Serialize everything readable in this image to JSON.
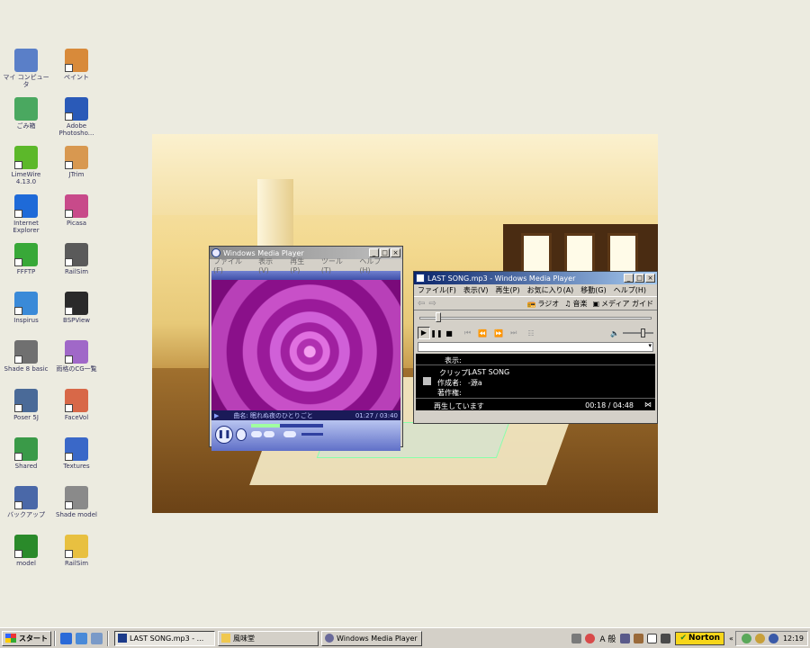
{
  "desktop": {
    "icons": [
      {
        "label": "マイ コンピュータ",
        "color": "#5a7fc8"
      },
      {
        "label": "ペイント",
        "color": "#d88a3a"
      },
      {
        "label": "ごみ箱",
        "color": "#4aa860"
      },
      {
        "label": "Adobe Photosho...",
        "color": "#2a5ab8"
      },
      {
        "label": "LimeWire 4.13.0",
        "color": "#5cb82a"
      },
      {
        "label": "JTrim",
        "color": "#d89850"
      },
      {
        "label": "Internet Explorer",
        "color": "#1e6ad8"
      },
      {
        "label": "Picasa",
        "color": "#c84a8a"
      },
      {
        "label": "FFFTP",
        "color": "#38a838"
      },
      {
        "label": "RailSim",
        "color": "#5a5a5a"
      },
      {
        "label": "Inspirus",
        "color": "#3a8ad8"
      },
      {
        "label": "BSPView",
        "color": "#2a2a2a"
      },
      {
        "label": "Shade 8 basic",
        "color": "#707070"
      },
      {
        "label": "雨格のCG一覧",
        "color": "#a068c8"
      },
      {
        "label": "Poser 5J",
        "color": "#4a6a98"
      },
      {
        "label": "FaceVol",
        "color": "#d86848"
      },
      {
        "label": "Shared",
        "color": "#3a9a48"
      },
      {
        "label": "Textures",
        "color": "#3a68c8"
      },
      {
        "label": "バックアップ",
        "color": "#4a68a8"
      },
      {
        "label": "Shade model",
        "color": "#8a8a8a"
      },
      {
        "label": "model",
        "color": "#2a8a2a"
      },
      {
        "label": "RailSim",
        "color": "#e8c040"
      }
    ]
  },
  "player_small": {
    "title": "Windows Media Player",
    "menu": [
      "ファイル(F)",
      "表示(V)",
      "再生(P)",
      "ツール(T)",
      "ヘルプ(H)"
    ],
    "now_playing": "曲名: 眠れぬ夜のひとりごと",
    "time": "01:27 / 03:40",
    "progress": 0.4
  },
  "player_main": {
    "title": "LAST SONG.mp3 - Windows Media Player",
    "menu": [
      "ファイル(F)",
      "表示(V)",
      "再生(P)",
      "お気に入り(A)",
      "移動(G)",
      "ヘルプ(H)"
    ],
    "toolbar": {
      "radio": "ラジオ",
      "music": "音楽",
      "media_guide": "メディア ガイド"
    },
    "seek_progress": 0.07,
    "info": {
      "display_label": "表示:",
      "clip_label": "クリップ:",
      "clip_value": "LAST SONG",
      "author_label": "作成者:",
      "author_value": "-源a",
      "copyright_label": "著作権:"
    },
    "status": "再生しています",
    "time": "00:18 / 04:48"
  },
  "taskbar": {
    "start_label": "スタート",
    "buttons": [
      "LAST SONG.mp3 - ...",
      "風味堂",
      "Windows Media Player"
    ],
    "ime": "A 般",
    "norton": "Norton",
    "clock": "12:19"
  }
}
